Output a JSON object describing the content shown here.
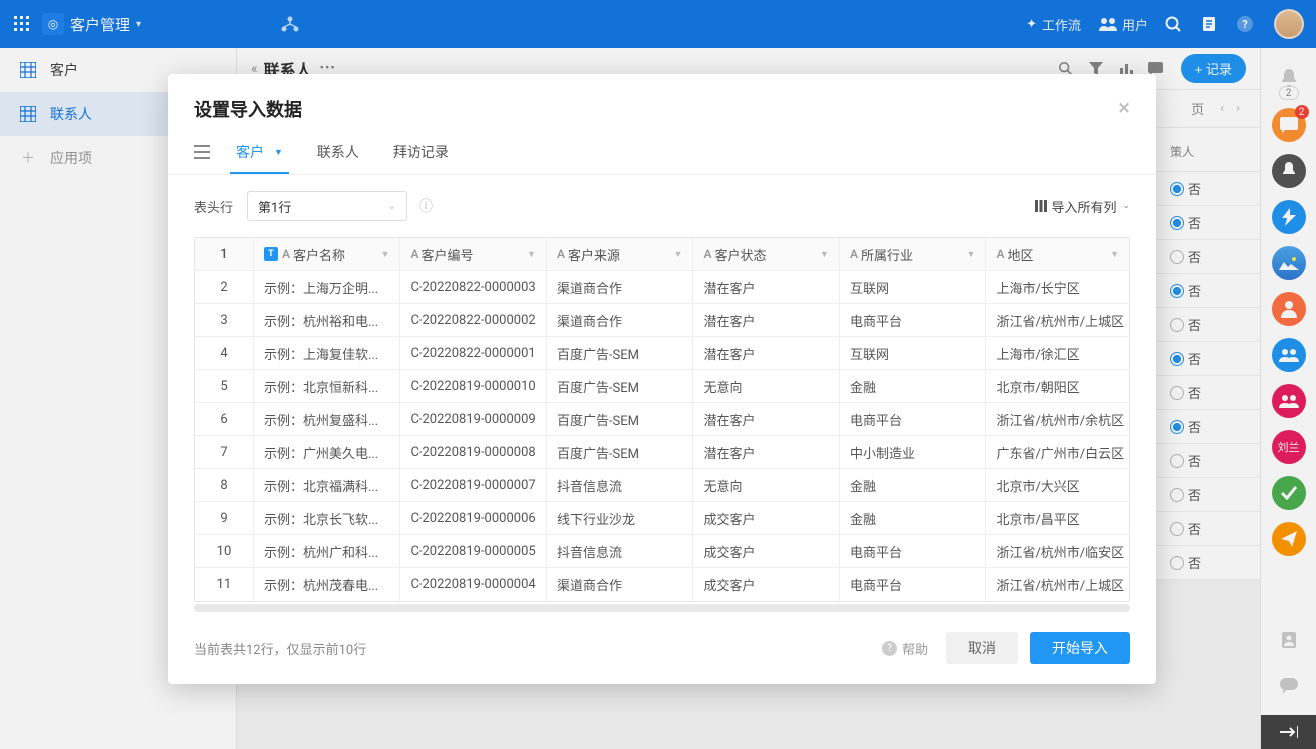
{
  "header": {
    "app_title": "客户管理",
    "workflow": "工作流",
    "users": "用户"
  },
  "sidebar": {
    "items": [
      {
        "label": "客户"
      },
      {
        "label": "联系人"
      },
      {
        "label": "应用项"
      }
    ]
  },
  "main": {
    "title": "联系人",
    "add_record": "+ 记录",
    "page_label": "页",
    "decision_header": "策人"
  },
  "bg_option_labels": {
    "no": "否"
  },
  "bg_rows_state": [
    true,
    true,
    false,
    true,
    false,
    true,
    false,
    true,
    false,
    false,
    false,
    false
  ],
  "rail_badge": "2",
  "dialog": {
    "title": "设置导入数据",
    "tabs": [
      "客户",
      "联系人",
      "拜访记录"
    ],
    "header_row_label": "表头行",
    "header_row_value": "第1行",
    "import_all_cols": "导入所有列",
    "columns": [
      "客户名称",
      "客户编号",
      "客户来源",
      "客户状态",
      "所属行业",
      "地区"
    ],
    "rows": [
      {
        "n": "2",
        "name": "示例：上海万企明...",
        "code": "C-20220822-0000003",
        "source": "渠道商合作",
        "status": "潜在客户",
        "industry": "互联网",
        "region": "上海市/长宁区"
      },
      {
        "n": "3",
        "name": "示例：杭州裕和电...",
        "code": "C-20220822-0000002",
        "source": "渠道商合作",
        "status": "潜在客户",
        "industry": "电商平台",
        "region": "浙江省/杭州市/上城区"
      },
      {
        "n": "4",
        "name": "示例：上海复佳软...",
        "code": "C-20220822-0000001",
        "source": "百度广告-SEM",
        "status": "潜在客户",
        "industry": "互联网",
        "region": "上海市/徐汇区"
      },
      {
        "n": "5",
        "name": "示例：北京恒新科...",
        "code": "C-20220819-0000010",
        "source": "百度广告-SEM",
        "status": "无意向",
        "industry": "金融",
        "region": "北京市/朝阳区"
      },
      {
        "n": "6",
        "name": "示例：杭州复盛科...",
        "code": "C-20220819-0000009",
        "source": "百度广告-SEM",
        "status": "潜在客户",
        "industry": "电商平台",
        "region": "浙江省/杭州市/余杭区"
      },
      {
        "n": "7",
        "name": "示例：广州美久电...",
        "code": "C-20220819-0000008",
        "source": "百度广告-SEM",
        "status": "潜在客户",
        "industry": "中小制造业",
        "region": "广东省/广州市/白云区"
      },
      {
        "n": "8",
        "name": "示例：北京福满科...",
        "code": "C-20220819-0000007",
        "source": "抖音信息流",
        "status": "无意向",
        "industry": "金融",
        "region": "北京市/大兴区"
      },
      {
        "n": "9",
        "name": "示例：北京长飞软...",
        "code": "C-20220819-0000006",
        "source": "线下行业沙龙",
        "status": "成交客户",
        "industry": "金融",
        "region": "北京市/昌平区"
      },
      {
        "n": "10",
        "name": "示例：杭州广和科...",
        "code": "C-20220819-0000005",
        "source": "抖音信息流",
        "status": "成交客户",
        "industry": "电商平台",
        "region": "浙江省/杭州市/临安区"
      },
      {
        "n": "11",
        "name": "示例：杭州茂春电...",
        "code": "C-20220819-0000004",
        "source": "渠道商合作",
        "status": "成交客户",
        "industry": "电商平台",
        "region": "浙江省/杭州市/上城区"
      }
    ],
    "header_row_num": "1",
    "footer_hint": "当前表共12行，仅显示前10行",
    "help": "帮助",
    "cancel": "取消",
    "start": "开始导入"
  }
}
